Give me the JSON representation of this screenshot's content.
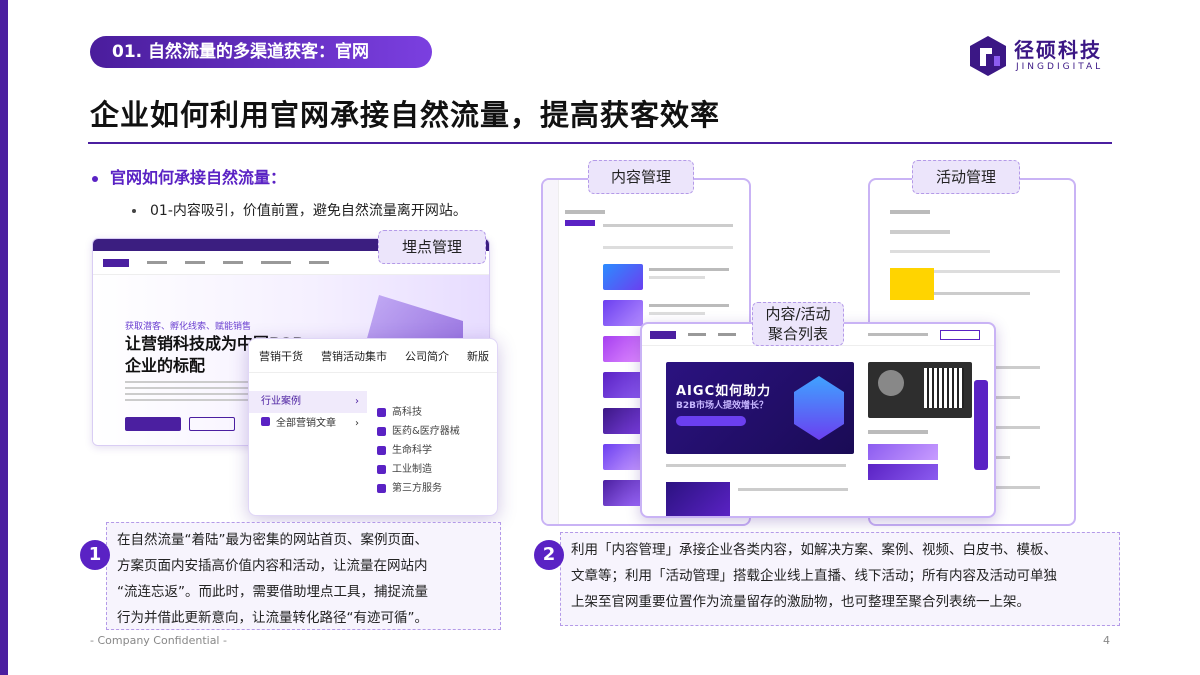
{
  "section_label": "01. 自然流量的多渠道获客：官网",
  "logo": {
    "cn": "径硕科技",
    "en": "JINGDIGITAL"
  },
  "title": "企业如何利用官网承接自然流量，提高获客效率",
  "bullets": {
    "level1": "官网如何承接自然流量：",
    "level2": "01-内容吸引，价值前置，避免自然流量离开网站。"
  },
  "tags": {
    "tracking_tool": "埋点管理",
    "content_mgmt": "内容管理",
    "activity_mgmt": "活动管理",
    "aggregate_list_line1": "内容/活动",
    "aggregate_list_line2": "聚合列表"
  },
  "site_mock": {
    "hero_tag": "获取潜客、孵化线索、赋能销售",
    "hero_line1": "让营销科技成为中国B2B",
    "hero_line2": "企业的标配"
  },
  "dropdown": {
    "tabs": [
      "营销干货",
      "营销活动集市",
      "公司简介",
      "新版"
    ],
    "left_items": [
      {
        "label": "行业案例",
        "arrow": "›"
      },
      {
        "label": "全部营销文章",
        "arrow": "›"
      }
    ],
    "right_items": [
      "高科技",
      "医药&医疗器械",
      "生命科学",
      "工业制造",
      "第三方服务"
    ]
  },
  "agg_banner": {
    "line1": "AIGC如何助力",
    "line2": "B2B市场人提效增长？"
  },
  "callout_1": {
    "number": "1",
    "lines": [
      "在自然流量“着陆”最为密集的网站首页、案例页面、",
      "方案页面内安插高价值内容和活动，让流量在网站内",
      "“流连忘返”。而此时，需要借助埋点工具，捕捉流量",
      "行为并借此更新意向，让流量转化路径“有迹可循”。"
    ]
  },
  "callout_2": {
    "number": "2",
    "lines": [
      "利用「内容管理」承接企业各类内容，如解决方案、案例、视频、白皮书、模板、",
      "文章等；利用「活动管理」搭载企业线上直播、线下活动；所有内容及活动可单独",
      "上架至官网重要位置作为流量留存的激励物，也可整理至聚合列表统一上架。"
    ]
  },
  "footer": {
    "confidential": "- Company Confidential -",
    "page": "4"
  },
  "colors": {
    "brand": "#4b1fa0",
    "accent": "#5a22c4"
  }
}
